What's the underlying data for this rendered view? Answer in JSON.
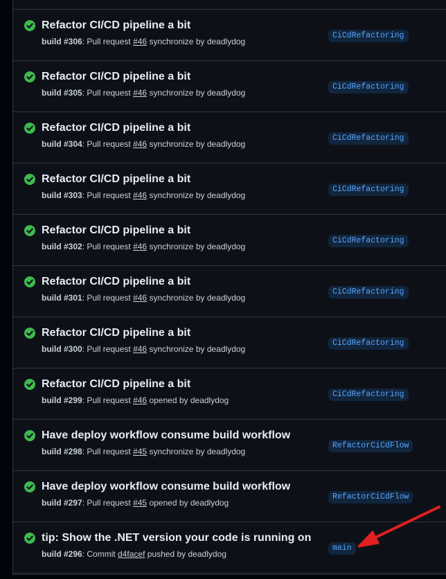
{
  "colors": {
    "background": "#0d1117",
    "border": "#30363d",
    "success": "#3fb950",
    "branch_bg": "#11253d",
    "branch_text": "#58a6ff",
    "annotation_arrow": "#e02020"
  },
  "runs": [
    {
      "title": "Refactor CI/CD pipeline a bit",
      "build": "build #306",
      "sep": ": ",
      "kind": "Pull request",
      "ref": "#46",
      "event": "synchronize",
      "by": "by deadlydog",
      "branch": "CiCdRefactoring",
      "status_icon": "check-circle-icon"
    },
    {
      "title": "Refactor CI/CD pipeline a bit",
      "build": "build #305",
      "sep": ": ",
      "kind": "Pull request",
      "ref": "#46",
      "event": "synchronize",
      "by": "by deadlydog",
      "branch": "CiCdRefactoring",
      "status_icon": "check-circle-icon"
    },
    {
      "title": "Refactor CI/CD pipeline a bit",
      "build": "build #304",
      "sep": ": ",
      "kind": "Pull request",
      "ref": "#46",
      "event": "synchronize",
      "by": "by deadlydog",
      "branch": "CiCdRefactoring",
      "status_icon": "check-circle-icon"
    },
    {
      "title": "Refactor CI/CD pipeline a bit",
      "build": "build #303",
      "sep": ": ",
      "kind": "Pull request",
      "ref": "#46",
      "event": "synchronize",
      "by": "by deadlydog",
      "branch": "CiCdRefactoring",
      "status_icon": "check-circle-icon"
    },
    {
      "title": "Refactor CI/CD pipeline a bit",
      "build": "build #302",
      "sep": ": ",
      "kind": "Pull request",
      "ref": "#46",
      "event": "synchronize",
      "by": "by deadlydog",
      "branch": "CiCdRefactoring",
      "status_icon": "check-circle-icon"
    },
    {
      "title": "Refactor CI/CD pipeline a bit",
      "build": "build #301",
      "sep": ": ",
      "kind": "Pull request",
      "ref": "#46",
      "event": "synchronize",
      "by": "by deadlydog",
      "branch": "CiCdRefactoring",
      "status_icon": "check-circle-icon"
    },
    {
      "title": "Refactor CI/CD pipeline a bit",
      "build": "build #300",
      "sep": ": ",
      "kind": "Pull request",
      "ref": "#46",
      "event": "synchronize",
      "by": "by deadlydog",
      "branch": "CiCdRefactoring",
      "status_icon": "check-circle-icon"
    },
    {
      "title": "Refactor CI/CD pipeline a bit",
      "build": "build #299",
      "sep": ": ",
      "kind": "Pull request",
      "ref": "#46",
      "event": "opened",
      "by": "by deadlydog",
      "branch": "CiCdRefactoring",
      "status_icon": "check-circle-icon"
    },
    {
      "title": "Have deploy workflow consume build workflow",
      "build": "build #298",
      "sep": ": ",
      "kind": "Pull request",
      "ref": "#45",
      "event": "synchronize",
      "by": "by deadlydog",
      "branch": "RefactorCiCdFlow",
      "status_icon": "check-circle-icon"
    },
    {
      "title": "Have deploy workflow consume build workflow",
      "build": "build #297",
      "sep": ": ",
      "kind": "Pull request",
      "ref": "#45",
      "event": "opened",
      "by": "by deadlydog",
      "branch": "RefactorCiCdFlow",
      "status_icon": "check-circle-icon"
    },
    {
      "title": "tip: Show the .NET version your code is running on",
      "build": "build #296",
      "sep": ": ",
      "kind": "Commit",
      "ref": "d4facef",
      "event": "pushed",
      "by": "by deadlydog",
      "branch": "main",
      "status_icon": "check-circle-icon"
    }
  ]
}
